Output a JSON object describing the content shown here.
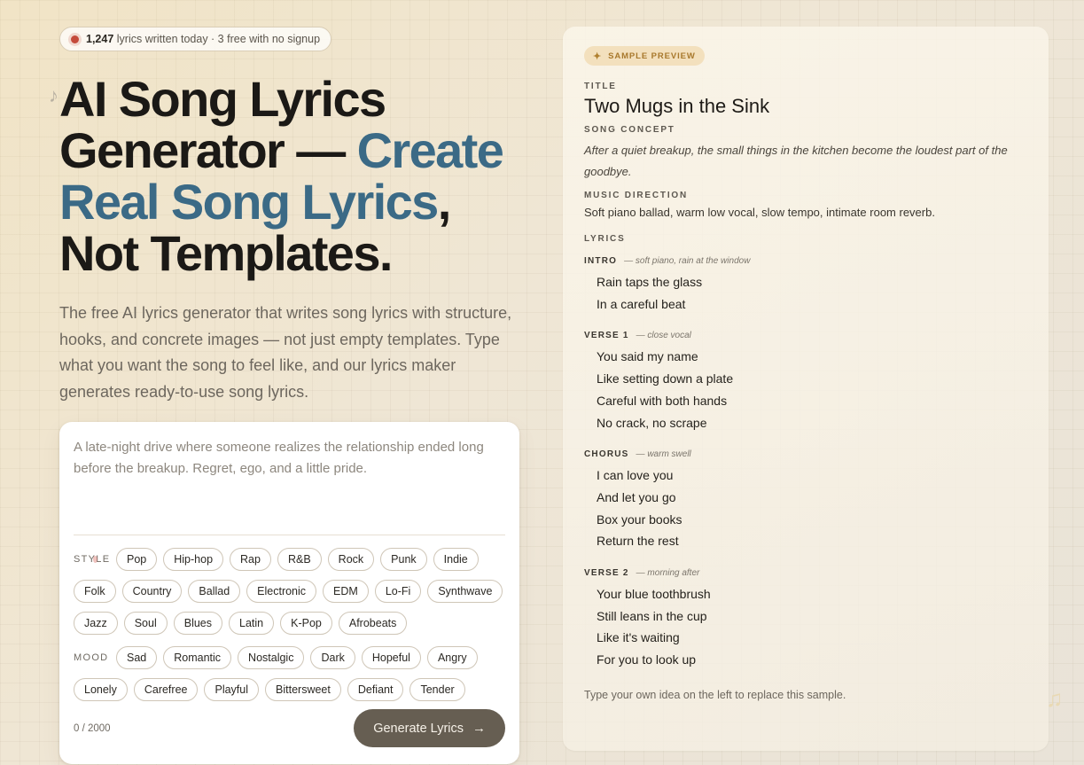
{
  "live_badge": {
    "count": "1,247",
    "text": "lyrics written today · 3 free with no signup"
  },
  "hero": {
    "title_part1": "AI Song Lyrics Generator — ",
    "title_accent": "Create Real Song Lyrics",
    "title_part2": ", Not Templates.",
    "note_glyph": "♪",
    "subtitle": "The free AI lyrics generator that writes song lyrics with structure, hooks, and concrete images — not just empty templates. Type what you want the song to feel like, and our lyrics maker generates ready-to-use song lyrics."
  },
  "composer": {
    "placeholder": "A late-night drive where someone realizes the relationship ended long before the breakup. Regret, ego, and a little pride.",
    "value": "",
    "style_label": "STYLE",
    "styles": [
      "Pop",
      "Hip-hop",
      "Rap",
      "R&B",
      "Rock",
      "Punk",
      "Indie",
      "Folk",
      "Country",
      "Ballad",
      "Electronic",
      "EDM",
      "Lo-Fi",
      "Synthwave",
      "Jazz",
      "Soul",
      "Blues",
      "Latin",
      "K-Pop",
      "Afrobeats"
    ],
    "mood_label": "MOOD",
    "moods": [
      "Sad",
      "Romantic",
      "Nostalgic",
      "Dark",
      "Hopeful",
      "Angry",
      "Lonely",
      "Carefree",
      "Playful",
      "Bittersweet",
      "Defiant",
      "Tender"
    ],
    "char_count": "0 / 2000",
    "generate_label": "Generate Lyrics",
    "generate_icon": "arrow-right-icon"
  },
  "preview": {
    "badge": "SAMPLE PREVIEW",
    "badge_icon": "sparkle-icon",
    "title_label": "TITLE",
    "title": "Two Mugs in the Sink",
    "concept_label": "SONG CONCEPT",
    "concept": "After a quiet breakup, the small things in the kitchen become the loudest part of the goodbye.",
    "direction_label": "MUSIC DIRECTION",
    "direction": "Soft piano ballad, warm low vocal, slow tempo, intimate room reverb.",
    "lyrics_label": "LYRICS",
    "stanzas": [
      {
        "name": "INTRO",
        "note": "— soft piano, rain at the window",
        "lines": [
          "Rain taps the glass",
          "In a careful beat"
        ]
      },
      {
        "name": "VERSE 1",
        "note": "— close vocal",
        "lines": [
          "You said my name",
          "Like setting down a plate",
          "Careful with both hands",
          "No crack, no scrape"
        ]
      },
      {
        "name": "CHORUS",
        "note": "— warm swell",
        "lines": [
          "I can love you",
          "And let you go",
          "Box your books",
          "Return the rest"
        ]
      },
      {
        "name": "VERSE 2",
        "note": "— morning after",
        "lines": [
          "Your blue toothbrush",
          "Still leans in the cup",
          "Like it's waiting",
          "For you to look up"
        ]
      }
    ],
    "hint": "Type your own idea on the left to replace this sample."
  },
  "colors": {
    "accent": "#3b6a86",
    "button": "#665e52",
    "badge_bg": "#f3e0bd",
    "live_dot": "#c44a3a"
  }
}
